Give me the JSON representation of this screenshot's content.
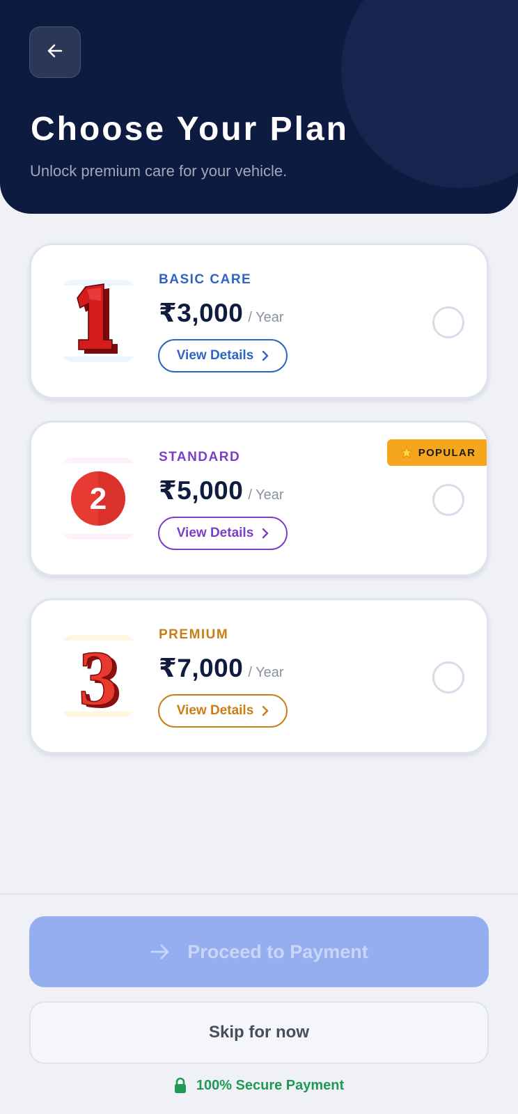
{
  "header": {
    "title": "Choose Your Plan",
    "subtitle": "Unlock premium care for your vehicle.",
    "back_icon": "arrow-left-icon"
  },
  "plans": [
    {
      "tier": "BASIC CARE",
      "price": "₹3,000",
      "period": "/ Year",
      "details_label": "View Details",
      "icon": "number-one-icon",
      "accent": "#2f64c3",
      "selected": false
    },
    {
      "tier": "STANDARD",
      "price": "₹5,000",
      "period": "/ Year",
      "details_label": "View Details",
      "icon": "number-two-badge-icon",
      "accent": "#7b3fc7",
      "badge": "POPULAR",
      "selected": false
    },
    {
      "tier": "PREMIUM",
      "price": "₹7,000",
      "period": "/ Year",
      "details_label": "View Details",
      "icon": "number-three-icon",
      "accent": "#cb7c14",
      "selected": false
    }
  ],
  "footer": {
    "proceed_label": "Proceed to Payment",
    "skip_label": "Skip for now",
    "secure_label": "100% Secure Payment"
  },
  "colors": {
    "header_bg": "#0e1b40",
    "page_bg": "#eff1f7",
    "proceed_bg": "#94aeef",
    "badge_bg": "#f6a61c",
    "secure_text": "#1f9a55"
  }
}
